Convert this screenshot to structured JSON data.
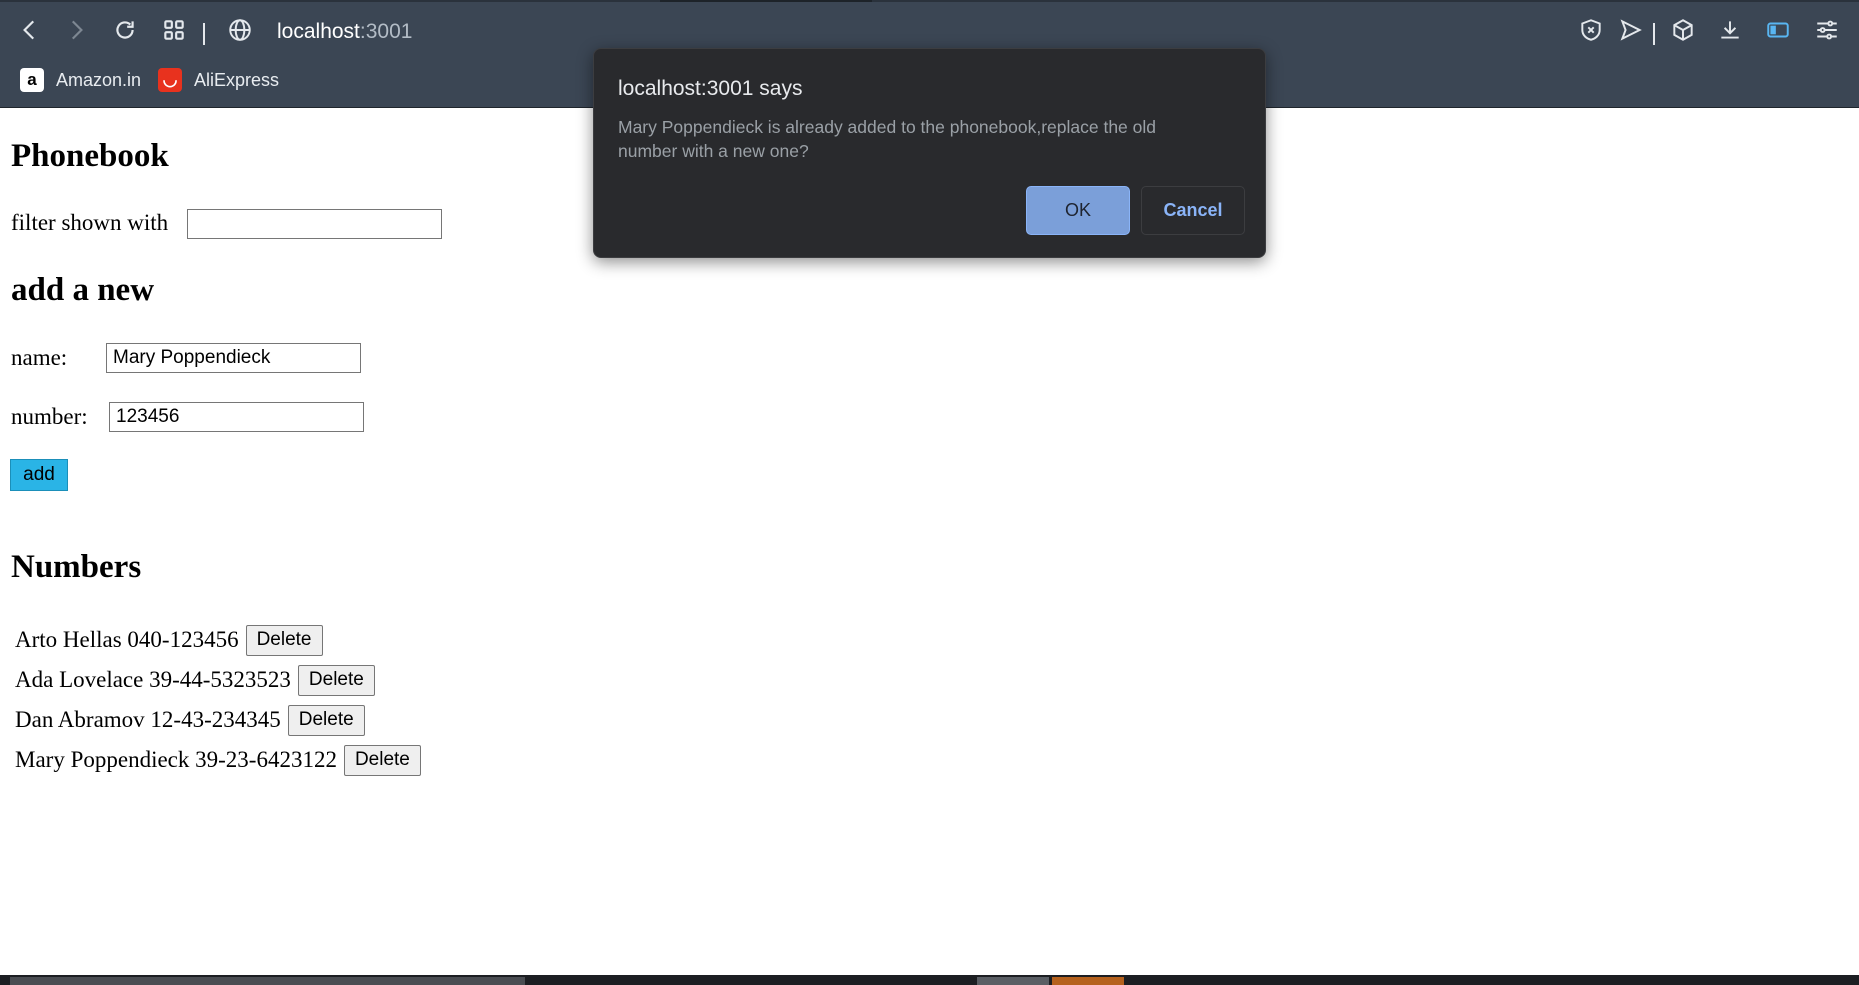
{
  "browser": {
    "url_host": "localhost",
    "url_port": ":3001",
    "bookmarks": [
      {
        "label": "Amazon.in",
        "icon": "amazon-icon",
        "icon_bg": "#ffffff",
        "icon_fg": "#000000",
        "glyph": "a"
      },
      {
        "label": "AliExpress",
        "icon": "aliexpress-icon",
        "icon_bg": "#e8321e",
        "icon_fg": "#ffffff",
        "glyph": "◡"
      }
    ]
  },
  "phonebook": {
    "title": "Phonebook",
    "filter_label": "filter shown with",
    "filter_value": "",
    "add_heading": "add a new",
    "name_label": "name:",
    "name_value": "Mary Poppendieck",
    "number_label": "number:",
    "number_value": "123456",
    "add_button": "add",
    "numbers_heading": "Numbers",
    "delete_label": "Delete",
    "entries": [
      {
        "text": "Arto Hellas 040-123456"
      },
      {
        "text": "Ada Lovelace 39-44-5323523"
      },
      {
        "text": "Dan Abramov 12-43-234345"
      },
      {
        "text": "Mary Poppendieck 39-23-6423122"
      }
    ]
  },
  "dialog": {
    "title": "localhost:3001 says",
    "message": "Mary Poppendieck is already added to the phonebook,replace the old number with a new one?",
    "ok_label": "OK",
    "cancel_label": "Cancel"
  },
  "colors": {
    "chrome_bg": "#3b4654",
    "dialog_bg": "#292a2d",
    "ok_button_bg": "#7b9fd9",
    "cancel_text": "#8ab4f8",
    "add_button_bg": "#2ab4e6"
  }
}
